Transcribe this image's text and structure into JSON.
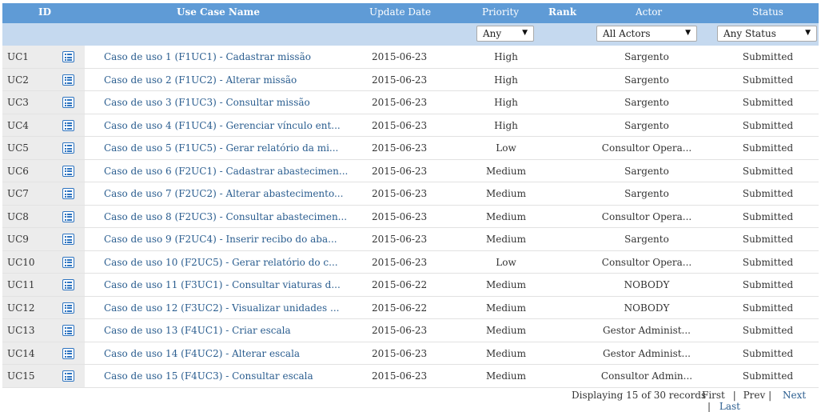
{
  "header": {
    "id": "ID",
    "name": "Use Case Name",
    "date": "Update Date",
    "priority": "Priority",
    "rank": "Rank",
    "actor": "Actor",
    "status": "Status"
  },
  "filters": {
    "priority": "Any",
    "actor": "All Actors",
    "status": "Any Status"
  },
  "rows": [
    {
      "id": "UC1",
      "name": "Caso de uso 1 (F1UC1) - Cadastrar missão",
      "date": "2015-06-23",
      "priority": "High",
      "actor": "Sargento",
      "status": "Submitted"
    },
    {
      "id": "UC2",
      "name": "Caso de uso 2 (F1UC2) - Alterar missão",
      "date": "2015-06-23",
      "priority": "High",
      "actor": "Sargento",
      "status": "Submitted"
    },
    {
      "id": "UC3",
      "name": "Caso de uso 3 (F1UC3) - Consultar missão",
      "date": "2015-06-23",
      "priority": "High",
      "actor": "Sargento",
      "status": "Submitted"
    },
    {
      "id": "UC4",
      "name": "Caso de uso 4 (F1UC4) - Gerenciar vínculo ent...",
      "date": "2015-06-23",
      "priority": "High",
      "actor": "Sargento",
      "status": "Submitted"
    },
    {
      "id": "UC5",
      "name": "Caso de uso 5 (F1UC5) - Gerar relatório da mi...",
      "date": "2015-06-23",
      "priority": "Low",
      "actor": "Consultor Opera...",
      "status": "Submitted"
    },
    {
      "id": "UC6",
      "name": "Caso de uso 6 (F2UC1) - Cadastrar abastecimen...",
      "date": "2015-06-23",
      "priority": "Medium",
      "actor": "Sargento",
      "status": "Submitted"
    },
    {
      "id": "UC7",
      "name": "Caso de uso 7 (F2UC2) - Alterar abastecimento...",
      "date": "2015-06-23",
      "priority": "Medium",
      "actor": "Sargento",
      "status": "Submitted"
    },
    {
      "id": "UC8",
      "name": "Caso de uso 8 (F2UC3) - Consultar abastecimen...",
      "date": "2015-06-23",
      "priority": "Medium",
      "actor": "Consultor Opera...",
      "status": "Submitted"
    },
    {
      "id": "UC9",
      "name": "Caso de uso 9 (F2UC4) - Inserir recibo do aba...",
      "date": "2015-06-23",
      "priority": "Medium",
      "actor": "Sargento",
      "status": "Submitted"
    },
    {
      "id": "UC10",
      "name": "Caso de uso 10 (F2UC5) - Gerar relatório do c...",
      "date": "2015-06-23",
      "priority": "Low",
      "actor": "Consultor Opera...",
      "status": "Submitted"
    },
    {
      "id": "UC11",
      "name": "Caso de uso 11 (F3UC1) - Consultar viaturas d...",
      "date": "2015-06-22",
      "priority": "Medium",
      "actor": "NOBODY",
      "status": "Submitted"
    },
    {
      "id": "UC12",
      "name": "Caso de uso 12 (F3UC2) - Visualizar unidades ...",
      "date": "2015-06-22",
      "priority": "Medium",
      "actor": "NOBODY",
      "status": "Submitted"
    },
    {
      "id": "UC13",
      "name": "Caso de uso 13 (F4UC1) - Criar escala",
      "date": "2015-06-23",
      "priority": "Medium",
      "actor": "Gestor Administ...",
      "status": "Submitted"
    },
    {
      "id": "UC14",
      "name": "Caso de uso 14 (F4UC2) - Alterar escala",
      "date": "2015-06-23",
      "priority": "Medium",
      "actor": "Gestor Administ...",
      "status": "Submitted"
    },
    {
      "id": "UC15",
      "name": "Caso de uso 15 (F4UC3) - Consultar escala",
      "date": "2015-06-23",
      "priority": "Medium",
      "actor": "Consultor Admin...",
      "status": "Submitted"
    }
  ],
  "footer": {
    "summary": "Displaying 15 of 30 records",
    "first": "First",
    "prev": "Prev",
    "next": "Next",
    "last": "Last",
    "sep": "|"
  },
  "icons": {
    "details": "list-details-icon",
    "dropdown": "chevron-down-icon"
  },
  "colors": {
    "header_bg": "#5f9bd6",
    "filter_bg": "#c5d9ef",
    "link": "#2a5d8f",
    "icon": "#2e74c0"
  }
}
